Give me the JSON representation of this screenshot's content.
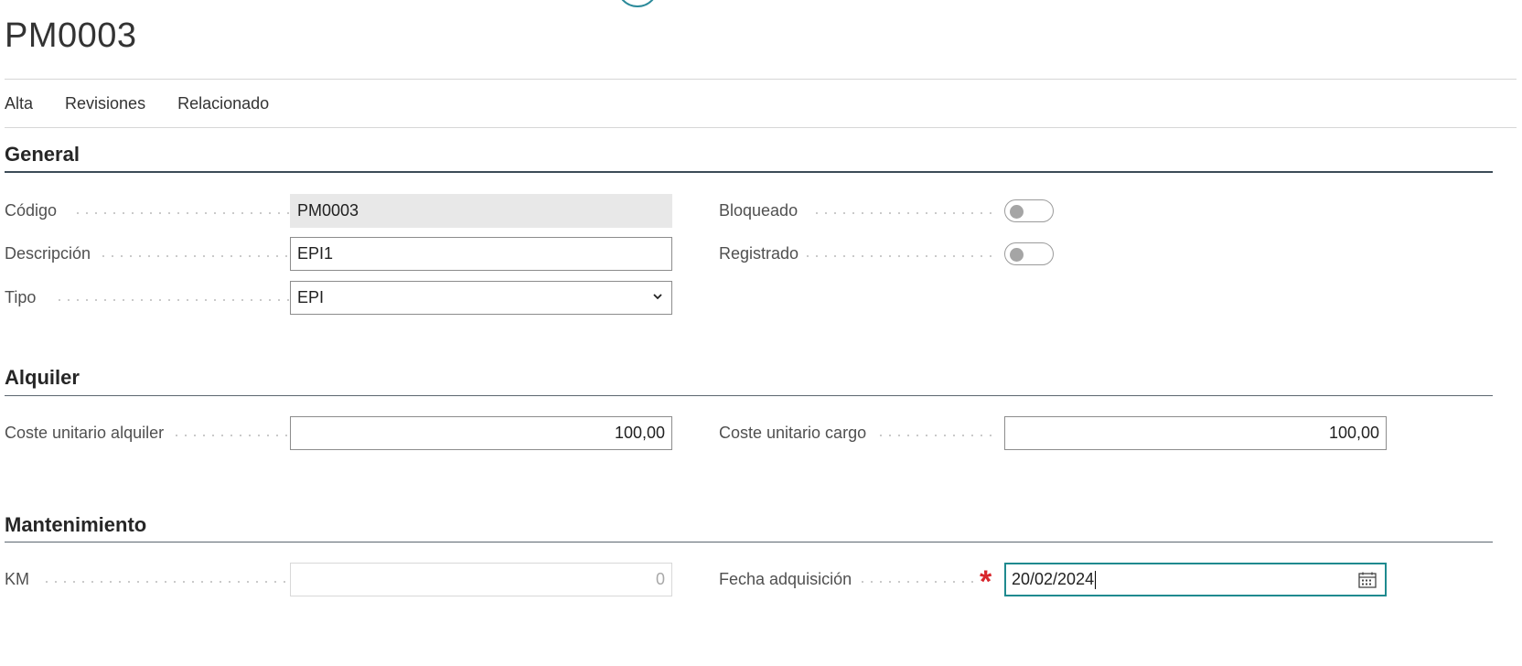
{
  "page": {
    "title": "PM0003"
  },
  "actions": [
    "Alta",
    "Revisiones",
    "Relacionado"
  ],
  "sections": {
    "general": {
      "title": "General",
      "codigo_label": "Código",
      "codigo_value": "PM0003",
      "descripcion_label": "Descripción",
      "descripcion_value": "EPI1",
      "tipo_label": "Tipo",
      "tipo_value": "EPI",
      "bloqueado_label": "Bloqueado",
      "bloqueado_on": false,
      "registrado_label": "Registrado",
      "registrado_on": false
    },
    "alquiler": {
      "title": "Alquiler",
      "coste_alquiler_label": "Coste unitario alquiler",
      "coste_alquiler_value": "100,00",
      "coste_cargo_label": "Coste unitario cargo",
      "coste_cargo_value": "100,00"
    },
    "mantenimiento": {
      "title": "Mantenimiento",
      "km_label": "KM",
      "km_value": "0",
      "fecha_label": "Fecha adquisición",
      "fecha_required_mark": "*",
      "fecha_value": "20/02/2024"
    }
  },
  "colors": {
    "accent": "#1f8a8f",
    "required": "#d8262c",
    "readonly_bg": "#e8e8e8"
  },
  "icons": [
    "chevron-down-icon",
    "calendar-icon"
  ]
}
